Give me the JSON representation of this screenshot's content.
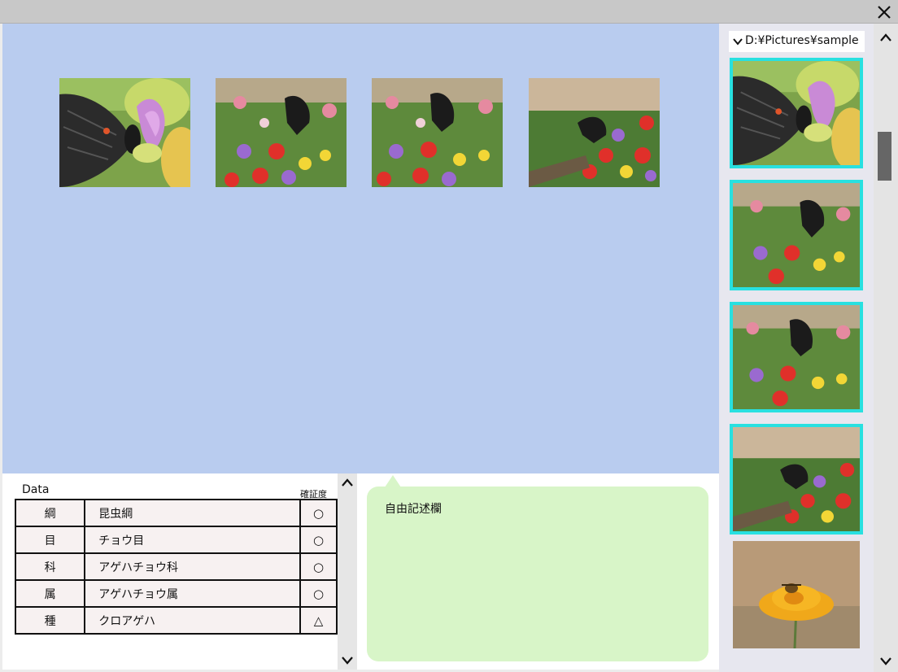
{
  "window": {
    "close_icon": "close-icon"
  },
  "canvas": {
    "background": "#b9ccef",
    "thumbnail_count": 4
  },
  "data_panel": {
    "title": "Data",
    "confidence_header": "確証度",
    "rows": [
      {
        "key": "綱",
        "value": "昆虫綱",
        "confidence": "○"
      },
      {
        "key": "目",
        "value": "チョウ目",
        "confidence": "○"
      },
      {
        "key": "科",
        "value": "アゲハチョウ科",
        "confidence": "○"
      },
      {
        "key": "属",
        "value": "アゲハチョウ属",
        "confidence": "○"
      },
      {
        "key": "種",
        "value": "クロアゲハ",
        "confidence": "△"
      }
    ]
  },
  "notes": {
    "label": "自由記述欄",
    "background": "#d8f5c8"
  },
  "sidebar": {
    "folder_path": "D:¥Pictures¥sample",
    "selection_color": "#28e0e0",
    "thumbnail_count": 5
  },
  "icons": {
    "chevron_up": "chevron-up-icon",
    "chevron_down": "chevron-down-icon"
  }
}
